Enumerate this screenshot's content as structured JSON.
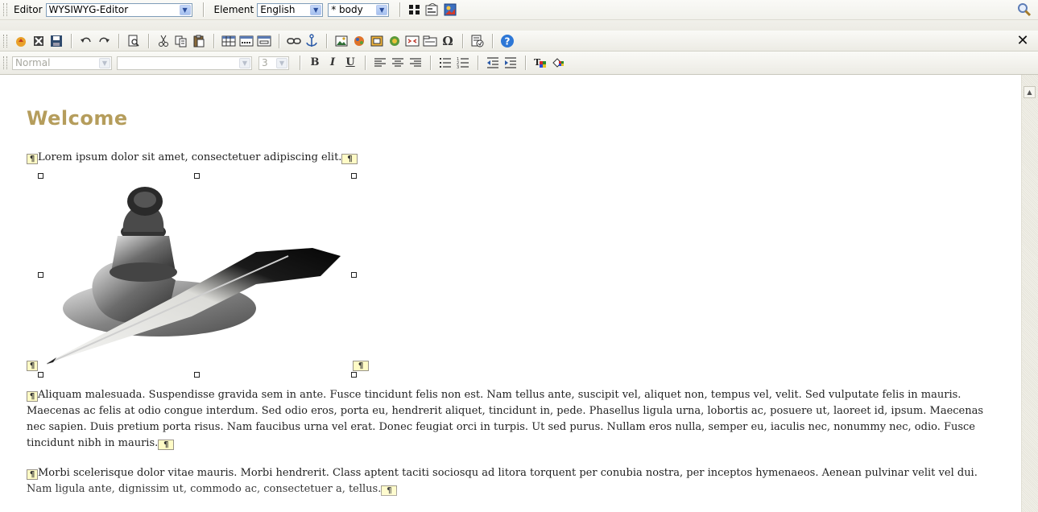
{
  "toolbar_top": {
    "editor_label": "Editor",
    "editor_value": "WYSIWYG-Editor",
    "element_label": "Element",
    "language_value": "English",
    "body_value": "* body"
  },
  "format_bar": {
    "style_value": "Normal",
    "font_value": "",
    "size_value": "3",
    "bold": "B",
    "italic": "I",
    "underline": "U"
  },
  "icons": {
    "block_view": "blocks-icon",
    "outline": "page-outline-icon",
    "preview": "preview-image-icon",
    "search": "search-icon",
    "close": "close-icon"
  },
  "content": {
    "heading": "Welcome",
    "para1": "Lorem ipsum dolor sit amet, consectetuer adipiscing elit.",
    "para2": "Aliquam malesuada. Suspendisse gravida sem in ante. Fusce tincidunt felis non est. Nam tellus ante, suscipit vel, aliquet non, tempus vel, velit. Sed vulputate felis in mauris. Maecenas ac felis at odio congue interdum. Sed odio eros, porta eu, hendrerit aliquet, tincidunt in, pede. Phasellus ligula urna, lobortis ac, posuere ut, laoreet id, ipsum. Maecenas nec sapien. Duis pretium porta risus. Nam faucibus urna vel erat. Donec feugiat orci in turpis. Ut sed purus. Nullam eros nulla, semper eu, iaculis nec, nonummy nec, odio. Fusce tincidunt nibh in mauris.",
    "para3": "Morbi scelerisque dolor vitae mauris. Morbi hendrerit. Class aptent taciti sociosqu ad litora torquent per conubia nostra, per inceptos hymenaeos. Aenean pulvinar velit vel dui. Nam ligula ante, dignissim ut, commodo ac, consectetuer a, tellus.",
    "para_start_mark": "¶",
    "para_end_mark": "¶"
  },
  "colors": {
    "heading": "#b59d5c",
    "toolbar_bg": "#ecebe4",
    "mark_bg": "#fffbc6"
  }
}
